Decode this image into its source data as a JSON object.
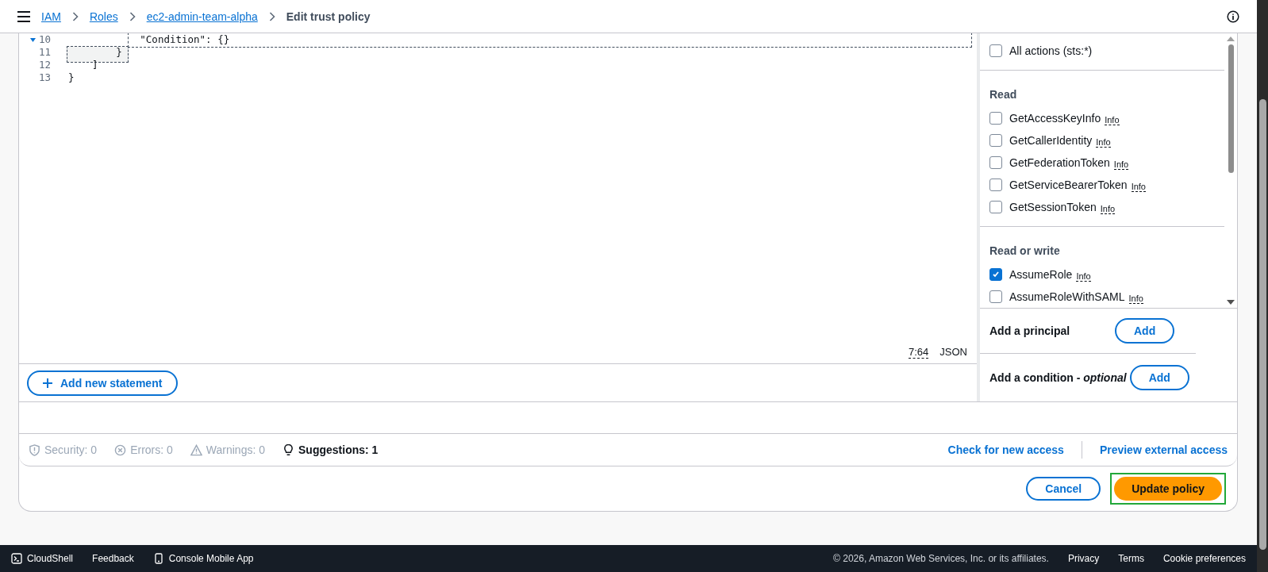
{
  "breadcrumbs": [
    {
      "label": "IAM",
      "kind": "link"
    },
    {
      "label": "Roles",
      "kind": "link"
    },
    {
      "label": "ec2-admin-team-alpha",
      "kind": "link"
    },
    {
      "label": "Edit trust policy",
      "kind": "current"
    }
  ],
  "editor": {
    "lines": [
      {
        "number": "10",
        "text": "            \"Condition\": {}",
        "foldable": true
      },
      {
        "number": "11",
        "text": "        }",
        "foldable": false
      },
      {
        "number": "12",
        "text": "    ]",
        "foldable": false
      },
      {
        "number": "13",
        "text": "}",
        "foldable": false
      }
    ],
    "cursor": "7:64",
    "language": "JSON",
    "add_statement": "Add new statement"
  },
  "actions_panel": {
    "all_actions": {
      "label": "All actions (sts:*)",
      "checked": false
    },
    "groups": [
      {
        "title": "Read",
        "items": [
          {
            "label": "GetAccessKeyInfo",
            "info": "Info",
            "checked": false
          },
          {
            "label": "GetCallerIdentity",
            "info": "Info",
            "checked": false
          },
          {
            "label": "GetFederationToken",
            "info": "Info",
            "checked": false
          },
          {
            "label": "GetServiceBearerToken",
            "info": "Info",
            "checked": false
          },
          {
            "label": "GetSessionToken",
            "info": "Info",
            "checked": false
          }
        ]
      },
      {
        "title": "Read or write",
        "items": [
          {
            "label": "AssumeRole",
            "info": "Info",
            "checked": true
          },
          {
            "label": "AssumeRoleWithSAML",
            "info": "Info",
            "checked": false
          }
        ]
      }
    ],
    "principal": {
      "label": "Add a principal",
      "button": "Add"
    },
    "condition": {
      "label": "Add a condition - ",
      "optional": "optional",
      "button": "Add"
    }
  },
  "validation": [
    {
      "kind": "security",
      "label": "Security: 0",
      "active": false
    },
    {
      "kind": "errors",
      "label": "Errors: 0",
      "active": false
    },
    {
      "kind": "warnings",
      "label": "Warnings: 0",
      "active": false
    },
    {
      "kind": "suggestions",
      "label": "Suggestions: 1",
      "active": true
    }
  ],
  "access_links": [
    "Check for new access",
    "Preview external access"
  ],
  "buttons": {
    "cancel": "Cancel",
    "submit": {
      "label": "Update policy",
      "highlighted": true
    }
  },
  "footer": {
    "left": [
      {
        "kind": "cloudshell",
        "label": "CloudShell"
      },
      {
        "kind": "plain",
        "label": "Feedback"
      },
      {
        "kind": "mobile",
        "label": "Console Mobile App"
      }
    ],
    "copyright": "© 2026, Amazon Web Services, Inc. or its affiliates.",
    "right": [
      "Privacy",
      "Terms",
      "Cookie preferences"
    ]
  }
}
